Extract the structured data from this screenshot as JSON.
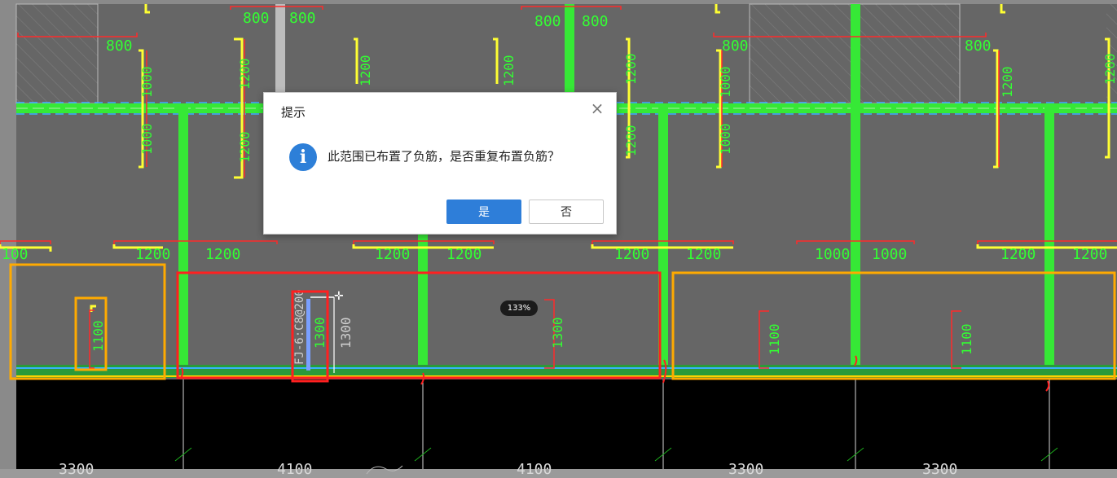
{
  "dialog": {
    "title": "提示",
    "close_glyph": "×",
    "info_glyph": "i",
    "message": "此范围已布置了负筋，是否重复布置负筋？",
    "yes_label": "是",
    "no_label": "否"
  },
  "zoom_badge": "133%",
  "rebar_label": "FJ-6:C8@200",
  "dims_top": [
    "800",
    "800",
    "800",
    "800",
    "800",
    "800",
    "800"
  ],
  "dims_mid": [
    "100",
    "1200",
    "1200",
    "1200",
    "1200",
    "1200",
    "1200",
    "1000",
    "1000",
    "1200",
    "1200"
  ],
  "dims_side": [
    "1000",
    "1000",
    "1200",
    "1200",
    "1200",
    "1200",
    "1200",
    "1200",
    "1000",
    "1000",
    "1200",
    "1200"
  ],
  "dims_bottom_row": [
    "1100",
    "1300",
    "1300",
    "1300",
    "1100",
    "1100"
  ],
  "axis_spans": [
    "3300",
    "4100",
    "4100",
    "3300",
    "3300"
  ],
  "colors": {
    "canvas": "#666666",
    "beam": "#36e836",
    "rebar_yellow": "#ffff33",
    "dim_red": "#ff2a2a",
    "dim_text": "#33ff33",
    "highlight_red": "#ff2020",
    "highlight_orange": "#ffaa00",
    "button_primary": "#2e7ed9"
  }
}
